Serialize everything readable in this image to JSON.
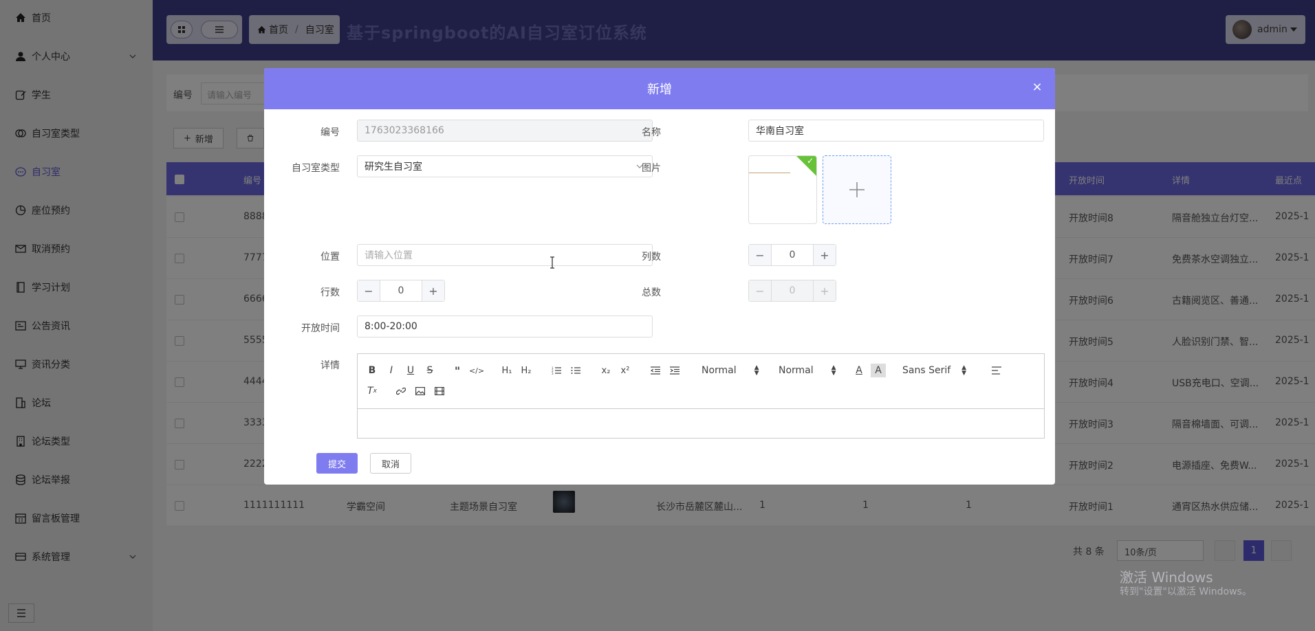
{
  "sidebar": {
    "items": [
      {
        "label": "首页",
        "icon": "home-icon"
      },
      {
        "label": "个人中心",
        "icon": "user-icon",
        "expandable": true
      },
      {
        "label": "学生",
        "icon": "edit-icon"
      },
      {
        "label": "自习室类型",
        "icon": "copy-icon"
      },
      {
        "label": "自习室",
        "icon": "chat-icon",
        "active": true
      },
      {
        "label": "座位预约",
        "icon": "pie-icon"
      },
      {
        "label": "取消预约",
        "icon": "mail-icon"
      },
      {
        "label": "学习计划",
        "icon": "book-icon"
      },
      {
        "label": "公告资讯",
        "icon": "news-icon"
      },
      {
        "label": "资讯分类",
        "icon": "screen-icon"
      },
      {
        "label": "论坛",
        "icon": "building-icon"
      },
      {
        "label": "论坛类型",
        "icon": "office-icon"
      },
      {
        "label": "论坛举报",
        "icon": "database-icon"
      },
      {
        "label": "留言板管理",
        "icon": "calendar-icon"
      },
      {
        "label": "系统管理",
        "icon": "card-icon",
        "expandable": true
      }
    ]
  },
  "header": {
    "breadcrumb": [
      "首页",
      "自习室"
    ],
    "title": "基于springboot的AI自习室订位系统",
    "user": "admin"
  },
  "background": {
    "search_label": "编号",
    "search_placeholder": "请输入编号",
    "add_button": "新增",
    "columns": [
      "编号",
      "开放时间",
      "详情",
      "最近点"
    ],
    "rows": [
      {
        "id": "8888",
        "time": "开放时间8",
        "detail": "隔音舱独立台灯空...",
        "date": "2025-1"
      },
      {
        "id": "7777",
        "time": "开放时间7",
        "detail": "免费茶水空调独立...",
        "date": "2025-1"
      },
      {
        "id": "6666",
        "time": "开放时间6",
        "detail": "古籍阅览区、善通...",
        "date": "2025-1"
      },
      {
        "id": "5555",
        "time": "开放时间5",
        "detail": "人脸识别门禁、智...",
        "date": "2025-1"
      },
      {
        "id": "4444",
        "time": "开放时间4",
        "detail": "USB充电口、空调...",
        "date": "2025-1"
      },
      {
        "id": "3333",
        "time": "开放时间3",
        "detail": "隔音棉墙面、可调...",
        "date": "2025-1"
      },
      {
        "id": "2222",
        "time": "开放时间2",
        "detail": "电源插座、免费W...",
        "date": "2025-1"
      },
      {
        "id": "1111111111",
        "name": "学霸空间",
        "type": "主题场景自习室",
        "location": "长沙市岳麓区麓山...",
        "c1": "1",
        "c2": "1",
        "c3": "1",
        "time": "开放时间1",
        "detail": "通宵区热水供应储...",
        "date": "2025-1"
      }
    ],
    "total": "共 8 条",
    "page_size": "10条/页",
    "current_page": "1"
  },
  "watermark": {
    "line1": "激活 Windows",
    "line2": "转到\"设置\"以激活 Windows。"
  },
  "dialog": {
    "title": "新增",
    "fields": {
      "code_label": "编号",
      "code_value": "1763023368166",
      "name_label": "名称",
      "name_value": "华南自习室",
      "type_label": "自习室类型",
      "type_value": "研究生自习室",
      "image_label": "图片",
      "location_label": "位置",
      "location_placeholder": "请输入位置",
      "cols_label": "列数",
      "cols_value": "0",
      "rows_label": "行数",
      "rows_value": "0",
      "total_label": "总数",
      "total_value": "0",
      "time_label": "开放时间",
      "time_value": "8:00-20:00",
      "detail_label": "详情"
    },
    "editor": {
      "header_select": "Normal",
      "size_select": "Normal",
      "font_select": "Sans Serif"
    },
    "submit": "提交",
    "cancel": "取消"
  }
}
